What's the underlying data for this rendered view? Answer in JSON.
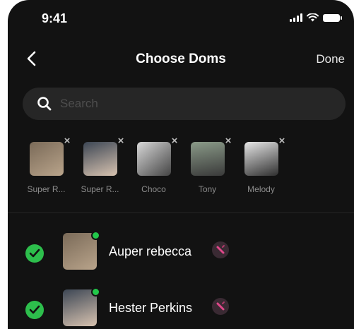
{
  "status": {
    "time": "9:41"
  },
  "nav": {
    "title": "Choose Doms",
    "done_label": "Done"
  },
  "search": {
    "placeholder": "Search"
  },
  "selected": [
    {
      "label": "Super R...",
      "colors": [
        "#7a6a58",
        "#b9a48b"
      ]
    },
    {
      "label": "Super R...",
      "colors": [
        "#3c4654",
        "#d8c3b0"
      ]
    },
    {
      "label": "Choco",
      "colors": [
        "#d8d8d8",
        "#444444"
      ]
    },
    {
      "label": "Tony",
      "colors": [
        "#8a9a88",
        "#3a3a3a"
      ]
    },
    {
      "label": "Melody",
      "colors": [
        "#e6e6e6",
        "#2f2f2f"
      ]
    }
  ],
  "remove_icon": "×",
  "list": [
    {
      "name": "Auper rebecca",
      "checked": true,
      "online": true
    },
    {
      "name": "Hester Perkins",
      "checked": true,
      "online": true
    }
  ],
  "colors": {
    "accent_green": "#2dbe4c",
    "tag_pink": "#e0488a"
  }
}
